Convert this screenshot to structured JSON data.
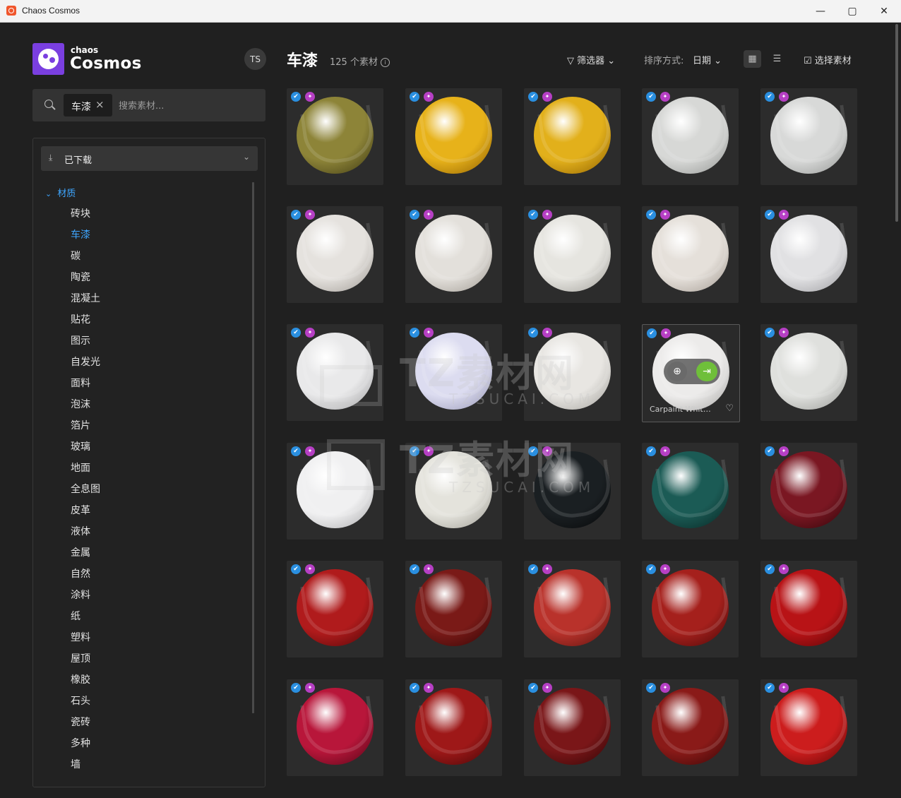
{
  "window": {
    "title": "Chaos Cosmos"
  },
  "brand": {
    "small": "chaos",
    "big": "Cosmos"
  },
  "user": {
    "initials": "TS"
  },
  "search": {
    "chip": "车漆",
    "placeholder": "搜索素材..."
  },
  "sidebar": {
    "downloaded_label": "已下载",
    "category_title": "材质",
    "items": [
      "砖块",
      "车漆",
      "碳",
      "陶瓷",
      "混凝土",
      "贴花",
      "图示",
      "自发光",
      "面料",
      "泡沫",
      "箔片",
      "玻璃",
      "地面",
      "全息图",
      "皮革",
      "液体",
      "金属",
      "自然",
      "涂料",
      "纸",
      "塑料",
      "屋顶",
      "橡胶",
      "石头",
      "瓷砖",
      "多种",
      "墙"
    ],
    "active_item": "车漆"
  },
  "header": {
    "title": "车漆",
    "count": "125 个素材",
    "filter_label": "筛选器",
    "sort_label": "排序方式:",
    "sort_value": "日期",
    "select_label": "选择素材"
  },
  "hover_tile": {
    "name": "Carpaint White..."
  },
  "watermark": {
    "text": "TZ素材网",
    "sub": "TZSUCAI.COM"
  },
  "icons": {
    "check": "downloaded-check-icon",
    "star": "premium-badge-icon"
  },
  "tiles": [
    {
      "color": "#8d8438",
      "dark": "#3a3510"
    },
    {
      "color": "#e7b21a",
      "dark": "#8a5a00"
    },
    {
      "color": "#e2b01b",
      "dark": "#8a5c00"
    },
    {
      "color": "#d7d8d6",
      "dark": "#8f918f"
    },
    {
      "color": "#d8d9d8",
      "dark": "#8f918f"
    },
    {
      "color": "#e5e2de",
      "dark": "#9a958f"
    },
    {
      "color": "#e3e0db",
      "dark": "#9a948c"
    },
    {
      "color": "#e6e5e0",
      "dark": "#9c9a94"
    },
    {
      "color": "#e5e0da",
      "dark": "#9e958c"
    },
    {
      "color": "#e1e1e3",
      "dark": "#96969a"
    },
    {
      "color": "#e9e9ea",
      "dark": "#9d9d9f"
    },
    {
      "color": "#dcdcf0",
      "dark": "#9090b0"
    },
    {
      "color": "#e8e6e2",
      "dark": "#9f9d98"
    },
    {
      "color": "#ecebea",
      "dark": "#a4a3a1"
    },
    {
      "color": "#dfe0dd",
      "dark": "#939491"
    },
    {
      "color": "#f0f0f1",
      "dark": "#a6a6a8"
    },
    {
      "color": "#e4e3dc",
      "dark": "#99978f"
    },
    {
      "color": "#1a1f22",
      "dark": "#050607"
    },
    {
      "color": "#1b5b55",
      "dark": "#06221f"
    },
    {
      "color": "#7a1722",
      "dark": "#2c0408"
    },
    {
      "color": "#b01b1c",
      "dark": "#4a0506"
    },
    {
      "color": "#7a1a17",
      "dark": "#2e0505"
    },
    {
      "color": "#b9322b",
      "dark": "#52100c"
    },
    {
      "color": "#a5201c",
      "dark": "#440606"
    },
    {
      "color": "#b81316",
      "dark": "#4e0305"
    },
    {
      "color": "#b8163a",
      "dark": "#4c0514"
    },
    {
      "color": "#9e1818",
      "dark": "#3e0505"
    },
    {
      "color": "#7a1618",
      "dark": "#2c0505"
    },
    {
      "color": "#8a1a18",
      "dark": "#320505"
    },
    {
      "color": "#cc1d1d",
      "dark": "#5a0404"
    }
  ]
}
